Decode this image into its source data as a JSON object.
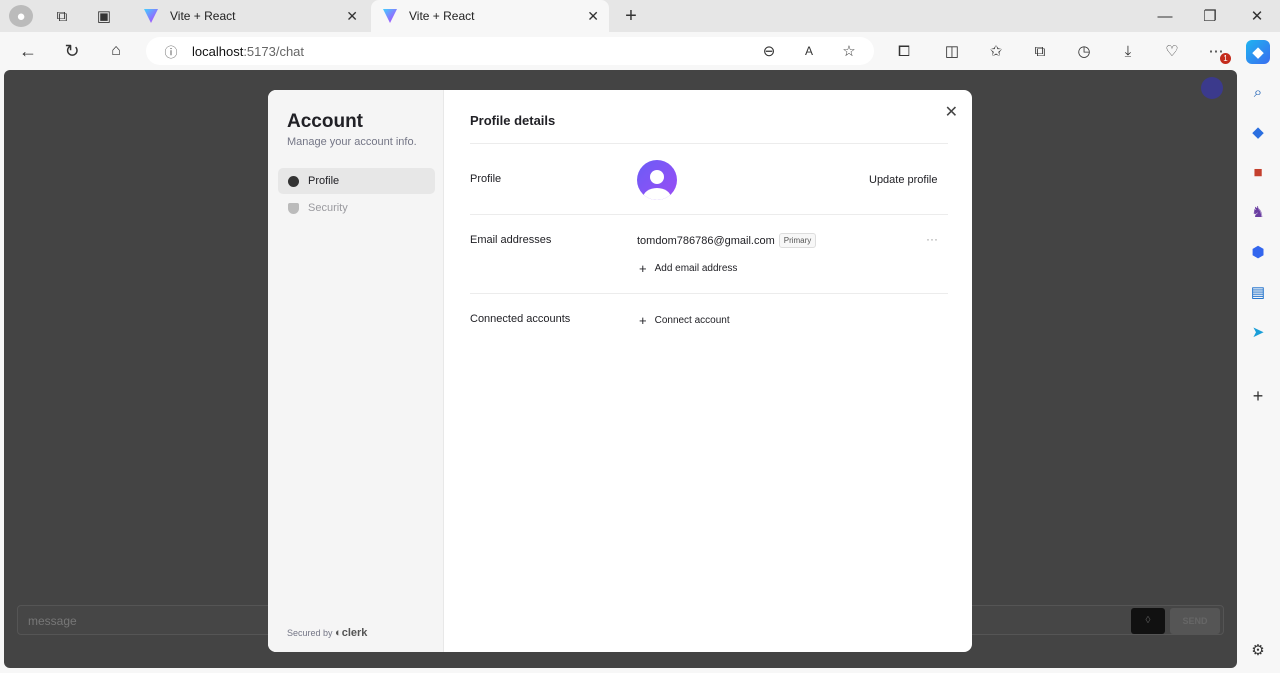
{
  "browser": {
    "tabs": [
      {
        "title": "Vite + React"
      },
      {
        "title": "Vite + React"
      }
    ],
    "url_host": "localhost",
    "url_path": ":5173/chat",
    "notification_count": "1"
  },
  "chat": {
    "message_placeholder": "message",
    "send_label": "SEND"
  },
  "modal": {
    "title": "Account",
    "subtitle": "Manage your account info.",
    "nav": [
      {
        "label": "Profile"
      },
      {
        "label": "Security"
      }
    ],
    "secured_by": "Secured by",
    "brand": "clerk",
    "section_title": "Profile details",
    "profile_label": "Profile",
    "update_profile": "Update profile",
    "email_label": "Email addresses",
    "email": "tomdom786786@gmail.com",
    "primary_badge": "Primary",
    "more": "···",
    "add_email": "Add email address",
    "connected_label": "Connected accounts",
    "connect_account": "Connect account"
  }
}
